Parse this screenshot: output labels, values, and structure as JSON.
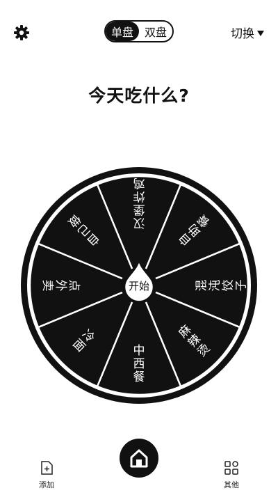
{
  "header": {
    "mode_tabs": [
      {
        "label": "单盘",
        "active": true
      },
      {
        "label": "双盘",
        "active": false
      }
    ],
    "switch_label": "切换"
  },
  "main": {
    "question": "今天吃什么?"
  },
  "wheel": {
    "segments": [
      "汉堡炸鸡",
      "自助餐",
      "混沌饺子",
      "麻辣烫",
      "中西餐",
      "冷面",
      "点外卖",
      "自己做"
    ],
    "start_label": "开始",
    "colors": {
      "segment": "#111111",
      "divider": "#ffffff",
      "rim": "#111111"
    }
  },
  "bottom_nav": {
    "add_label": "添加",
    "other_label": "其他"
  },
  "icons": {
    "settings": "gear-icon",
    "add": "add-file-icon",
    "home": "home-icon",
    "other": "grid-icon"
  }
}
